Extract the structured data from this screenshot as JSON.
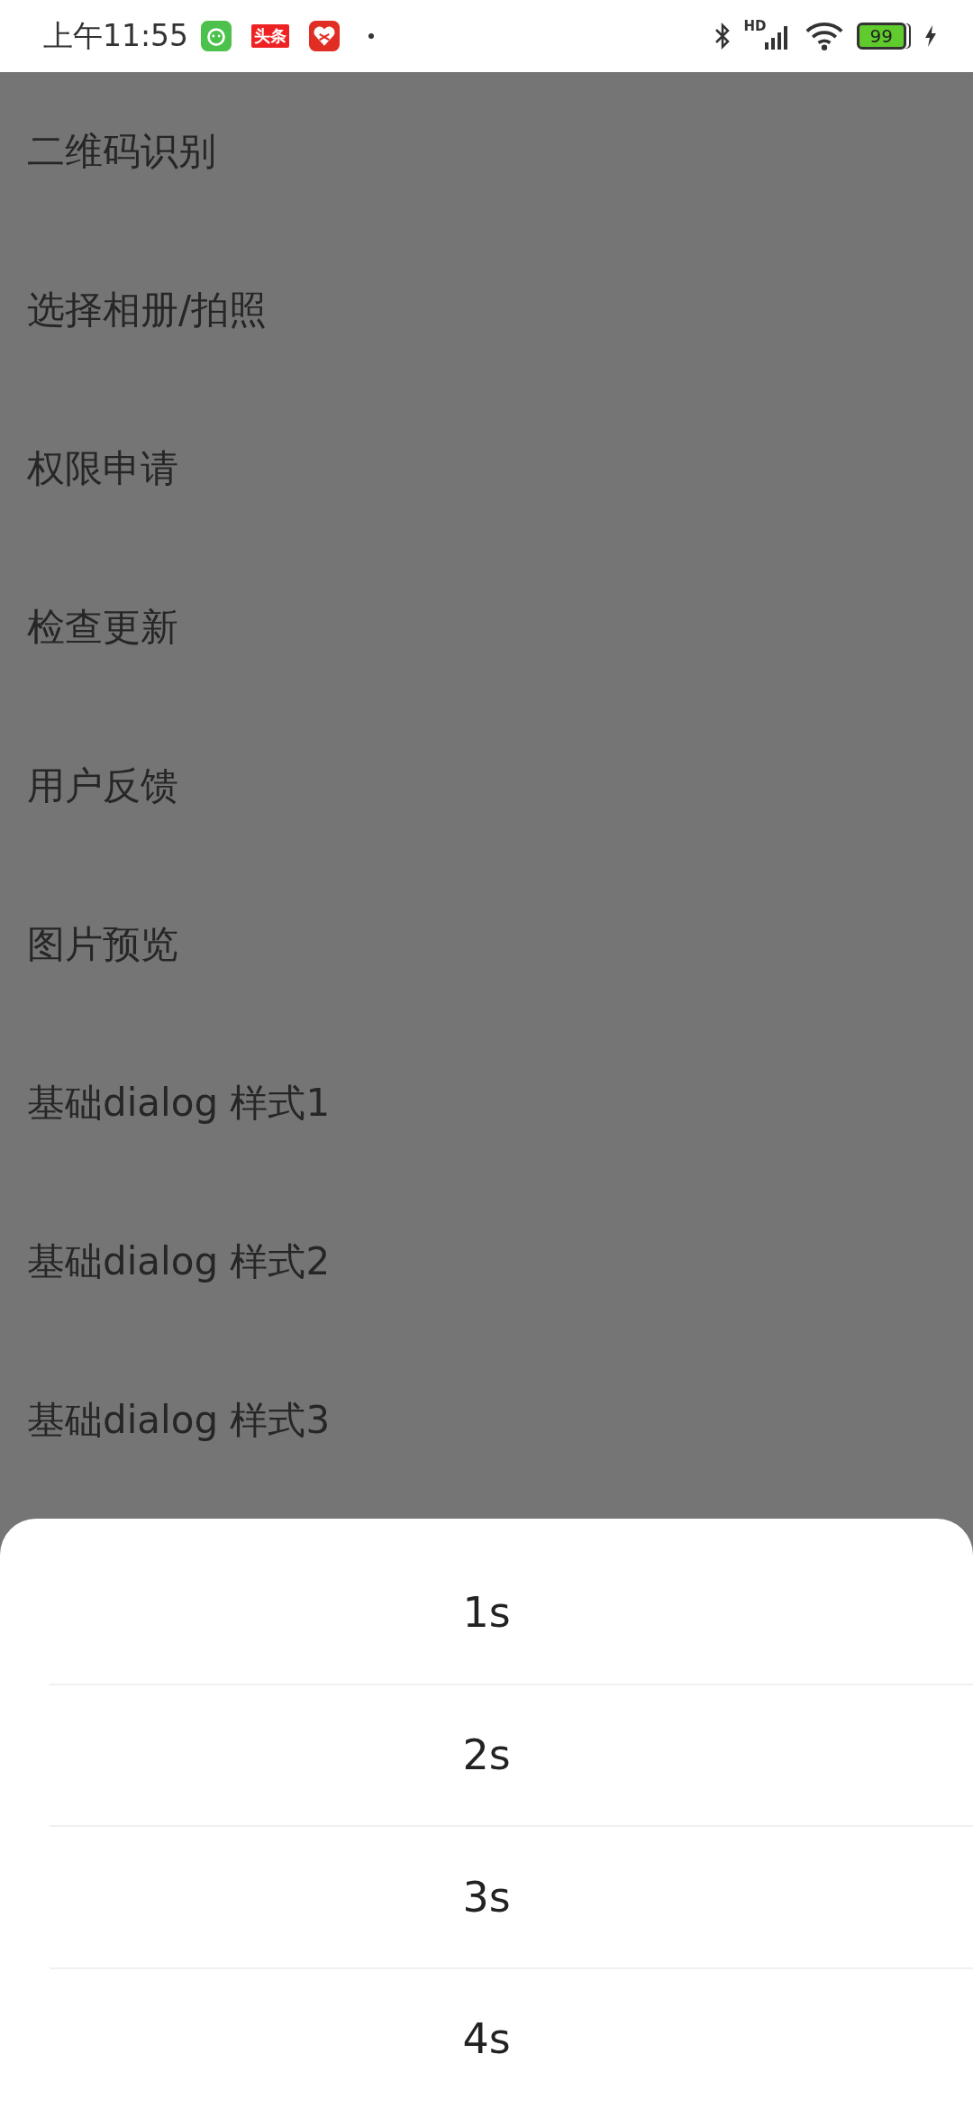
{
  "status_bar": {
    "time": "上午11:55",
    "app_badge": "头条",
    "signal_label": "HD",
    "battery": "99"
  },
  "menu_items": [
    "二维码识别",
    "选择相册/拍照",
    "权限申请",
    "检查更新",
    "用户反馈",
    "图片预览",
    "基础dialog 样式1",
    "基础dialog 样式2",
    "基础dialog 样式3"
  ],
  "bottom_sheet": {
    "options": [
      "1s",
      "2s",
      "3s",
      "4s"
    ]
  }
}
